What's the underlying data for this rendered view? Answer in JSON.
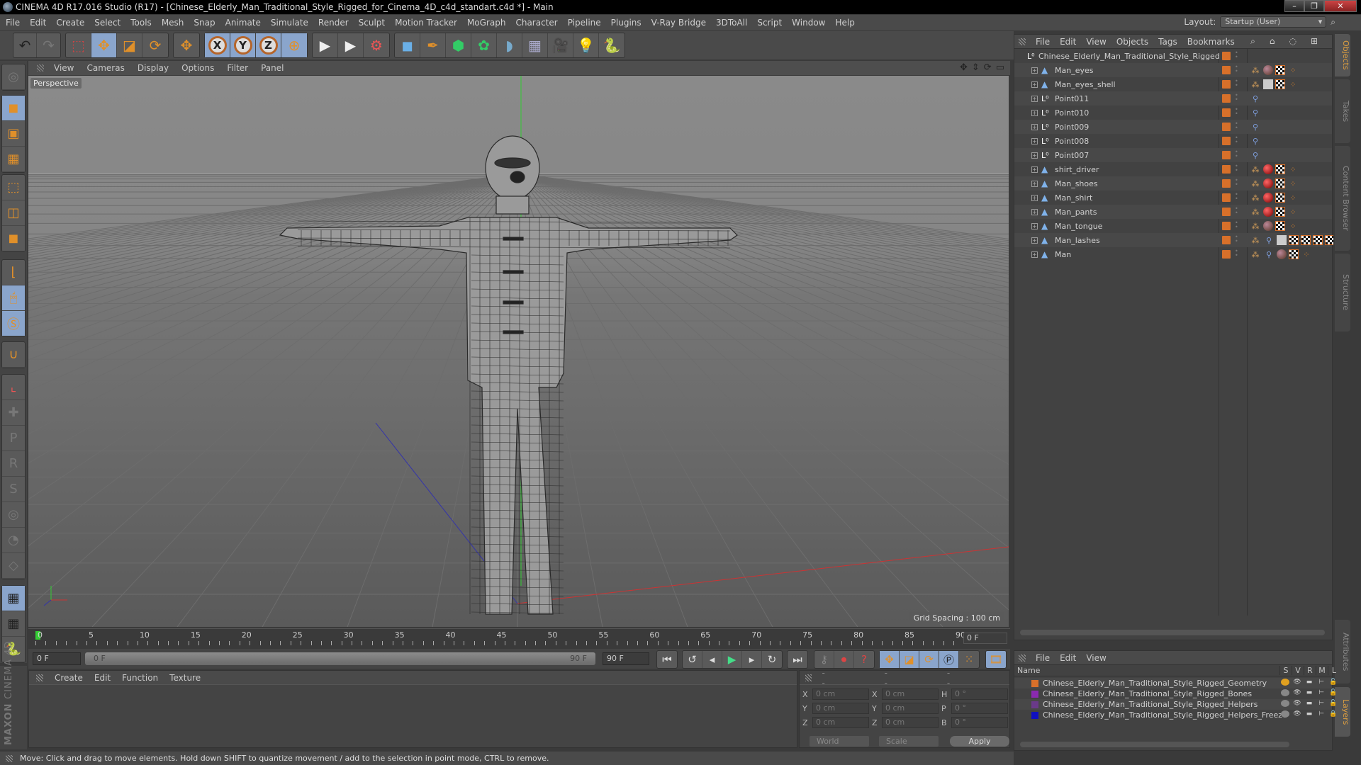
{
  "window": {
    "title": "CINEMA 4D R17.016 Studio (R17) - [Chinese_Elderly_Man_Traditional_Style_Rigged_for_Cinema_4D_c4d_standart.c4d *] - Main",
    "controls": {
      "minimize": "–",
      "maximize": "❐",
      "close": "✕"
    }
  },
  "menubar": {
    "items": [
      "File",
      "Edit",
      "Create",
      "Select",
      "Tools",
      "Mesh",
      "Snap",
      "Animate",
      "Simulate",
      "Render",
      "Sculpt",
      "Motion Tracker",
      "MoGraph",
      "Character",
      "Pipeline",
      "Plugins",
      "V-Ray Bridge",
      "3DToAll",
      "Script",
      "Window",
      "Help"
    ],
    "layout_label": "Layout:",
    "layout_value": "Startup (User)"
  },
  "toolbar": {
    "undo": "↶",
    "redo": "↷",
    "select": "⬚",
    "move": "✥",
    "scale": "◪",
    "rotate": "⟳",
    "last_tool": "✥",
    "axis_x": "X",
    "axis_y": "Y",
    "axis_z": "Z",
    "world": "⊕",
    "render_view": "▶",
    "render_pv": "▶",
    "render_settings": "⚙",
    "cube": "◼",
    "pen": "✒",
    "subdiv": "⬢",
    "cloner": "✿",
    "deformer": "◗",
    "floor": "▦",
    "camera": "🎥",
    "light": "💡",
    "python": "🐍"
  },
  "left_tools": [
    "model",
    "object",
    "texture",
    "workplane",
    "points",
    "edges",
    "polygons",
    "axis",
    "tweak",
    "solo",
    "magnet",
    "enable-axis",
    "snap1",
    "snap-p",
    "snap-r",
    "snap-psr",
    "snap-circle",
    "snap-2",
    "snap-3",
    "workplane-lock",
    "workplane-rotate",
    "python"
  ],
  "viewport": {
    "menu": [
      "View",
      "Cameras",
      "Display",
      "Options",
      "Filter",
      "Panel"
    ],
    "camera_label": "Perspective",
    "grid_spacing": "Grid Spacing : 100 cm"
  },
  "timeline": {
    "ticks": [
      "0",
      "5",
      "10",
      "15",
      "20",
      "25",
      "30",
      "35",
      "40",
      "45",
      "50",
      "55",
      "60",
      "65",
      "70",
      "75",
      "80",
      "85",
      "90"
    ],
    "current_frame": "0 F",
    "start_field": "0 F",
    "range_start": "0 F",
    "range_end": "90 F",
    "end_field": "90 F"
  },
  "material_manager": {
    "menu": [
      "Create",
      "Edit",
      "Function",
      "Texture"
    ]
  },
  "coordinates": {
    "headers": [
      "--",
      "--",
      "--"
    ],
    "rows": [
      {
        "l1": "X",
        "v1": "0 cm",
        "l2": "X",
        "v2": "0 cm",
        "l3": "H",
        "v3": "0 °"
      },
      {
        "l1": "Y",
        "v1": "0 cm",
        "l2": "Y",
        "v2": "0 cm",
        "l3": "P",
        "v3": "0 °"
      },
      {
        "l1": "Z",
        "v1": "0 cm",
        "l2": "Z",
        "v2": "0 cm",
        "l3": "B",
        "v3": "0 °"
      }
    ],
    "mode": "World",
    "transform": "Scale",
    "apply": "Apply"
  },
  "brand": {
    "line1": "MAXON",
    "line2": "CINEMA 4D"
  },
  "status": "Move: Click and drag to move elements. Hold down SHIFT to quantize movement / add to the selection in point mode, CTRL to remove.",
  "object_manager": {
    "menu": [
      "File",
      "Edit",
      "View",
      "Objects",
      "Tags",
      "Bookmarks"
    ],
    "root": "Chinese_Elderly_Man_Traditional_Style_Rigged",
    "layer_color": "#d7702a",
    "objects": [
      {
        "name": "Man_eyes",
        "type": "mesh",
        "tags": [
          "phong",
          "sph",
          "chk",
          "dots"
        ]
      },
      {
        "name": "Man_eyes_shell",
        "type": "mesh",
        "tags": [
          "phong",
          "sphw",
          "chk",
          "dots"
        ]
      },
      {
        "name": "Point011",
        "type": "null",
        "tags": [
          "pin"
        ]
      },
      {
        "name": "Point010",
        "type": "null",
        "tags": [
          "pin"
        ]
      },
      {
        "name": "Point009",
        "type": "null",
        "tags": [
          "pin"
        ]
      },
      {
        "name": "Point008",
        "type": "null",
        "tags": [
          "pin"
        ]
      },
      {
        "name": "Point007",
        "type": "null",
        "tags": [
          "pin"
        ]
      },
      {
        "name": "shirt_driver",
        "type": "mesh",
        "tags": [
          "phong",
          "sphr",
          "chk",
          "dots"
        ]
      },
      {
        "name": "Man_shoes",
        "type": "mesh",
        "tags": [
          "phong",
          "sphr",
          "chk",
          "dots"
        ]
      },
      {
        "name": "Man_shirt",
        "type": "mesh",
        "tags": [
          "phong",
          "sphr",
          "chk",
          "dots"
        ]
      },
      {
        "name": "Man_pants",
        "type": "mesh",
        "tags": [
          "phong",
          "sphr",
          "chk",
          "dots"
        ]
      },
      {
        "name": "Man_tongue",
        "type": "mesh",
        "tags": [
          "phong",
          "sph",
          "chk",
          "dots"
        ]
      },
      {
        "name": "Man_lashes",
        "type": "mesh",
        "tags": [
          "phong",
          "pin",
          "sphw",
          "chk",
          "chk",
          "chk",
          "chk"
        ]
      },
      {
        "name": "Man",
        "type": "mesh",
        "tags": [
          "phong",
          "pin",
          "sph",
          "chk",
          "dots"
        ]
      }
    ]
  },
  "side_tabs_top": [
    "Objects",
    "Takes",
    "Content Browser",
    "Structure"
  ],
  "side_tabs_bottom": [
    "Attributes",
    "Layers"
  ],
  "layer_manager": {
    "menu": [
      "File",
      "Edit",
      "View"
    ],
    "columns": [
      "Name",
      "S",
      "V",
      "R",
      "M",
      "L"
    ],
    "layers": [
      {
        "name": "Chinese_Elderly_Man_Traditional_Style_Rigged_Geometry",
        "color": "#d7702a",
        "solo": true,
        "locked": false
      },
      {
        "name": "Chinese_Elderly_Man_Traditional_Style_Rigged_Bones",
        "color": "#8a2ab0",
        "solo": false,
        "locked": false
      },
      {
        "name": "Chinese_Elderly_Man_Traditional_Style_Rigged_Helpers",
        "color": "#6a3a8a",
        "solo": false,
        "locked": false
      },
      {
        "name": "Chinese_Elderly_Man_Traditional_Style_Rigged_Helpers_Freeze",
        "color": "#1010c0",
        "solo": false,
        "locked": true
      }
    ]
  }
}
